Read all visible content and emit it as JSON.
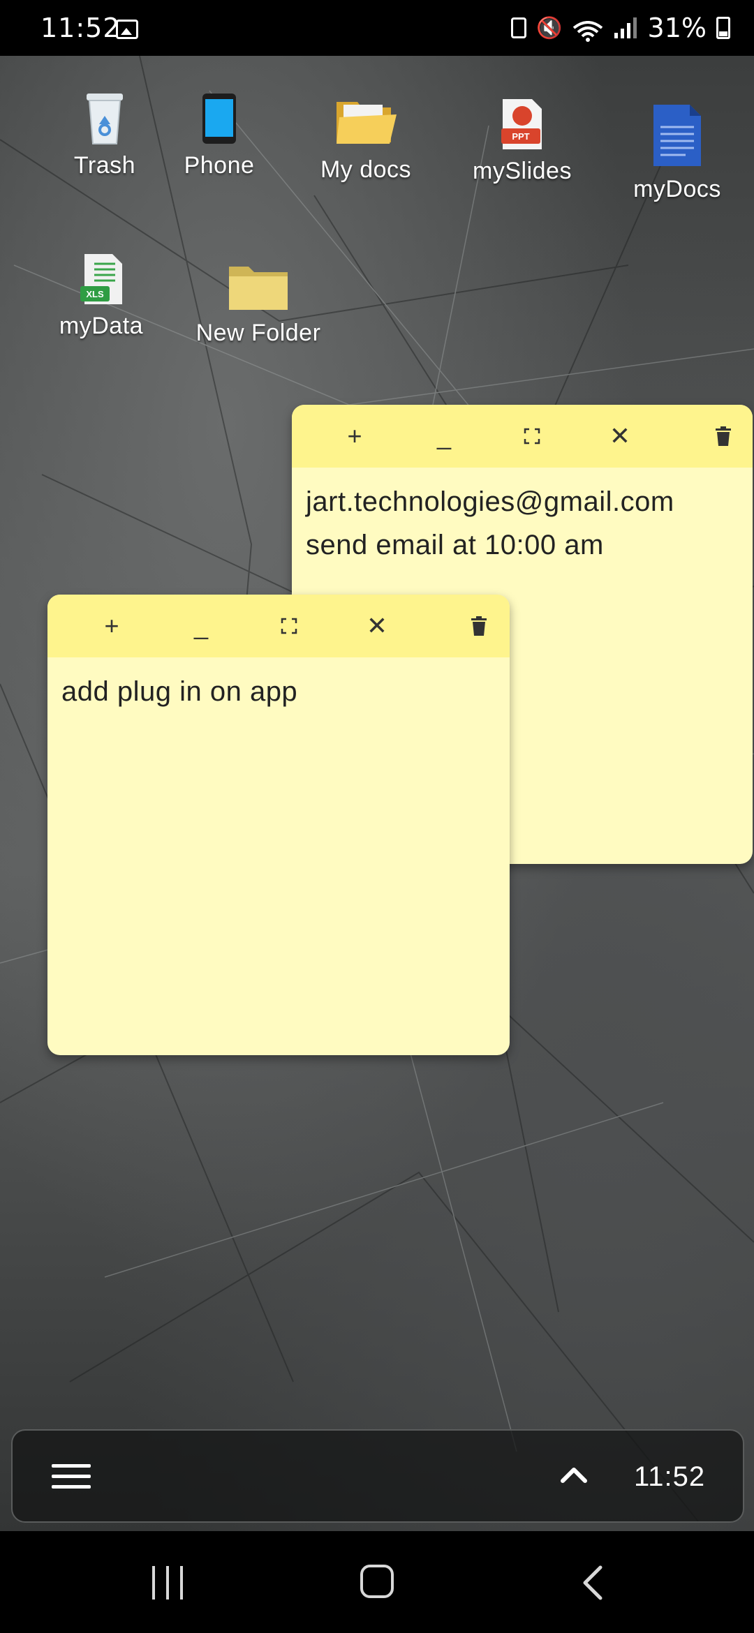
{
  "status_bar": {
    "time": "11:52",
    "battery": "31%"
  },
  "desktop": {
    "icons": [
      {
        "label": "Trash"
      },
      {
        "label": "Phone"
      },
      {
        "label": "My docs"
      },
      {
        "label": "mySlides"
      },
      {
        "label": "myDocs"
      },
      {
        "label": "myData"
      },
      {
        "label": "New Folder"
      }
    ],
    "notes": [
      {
        "lines": [
          "jart.technologies@gmail.com",
          "send email at 10:00 am"
        ]
      },
      {
        "lines": [
          "add plug in on app"
        ]
      }
    ]
  },
  "note_toolbar": {
    "add": "+",
    "minimize": "_",
    "close": "✕"
  },
  "taskbar": {
    "time": "11:52"
  }
}
